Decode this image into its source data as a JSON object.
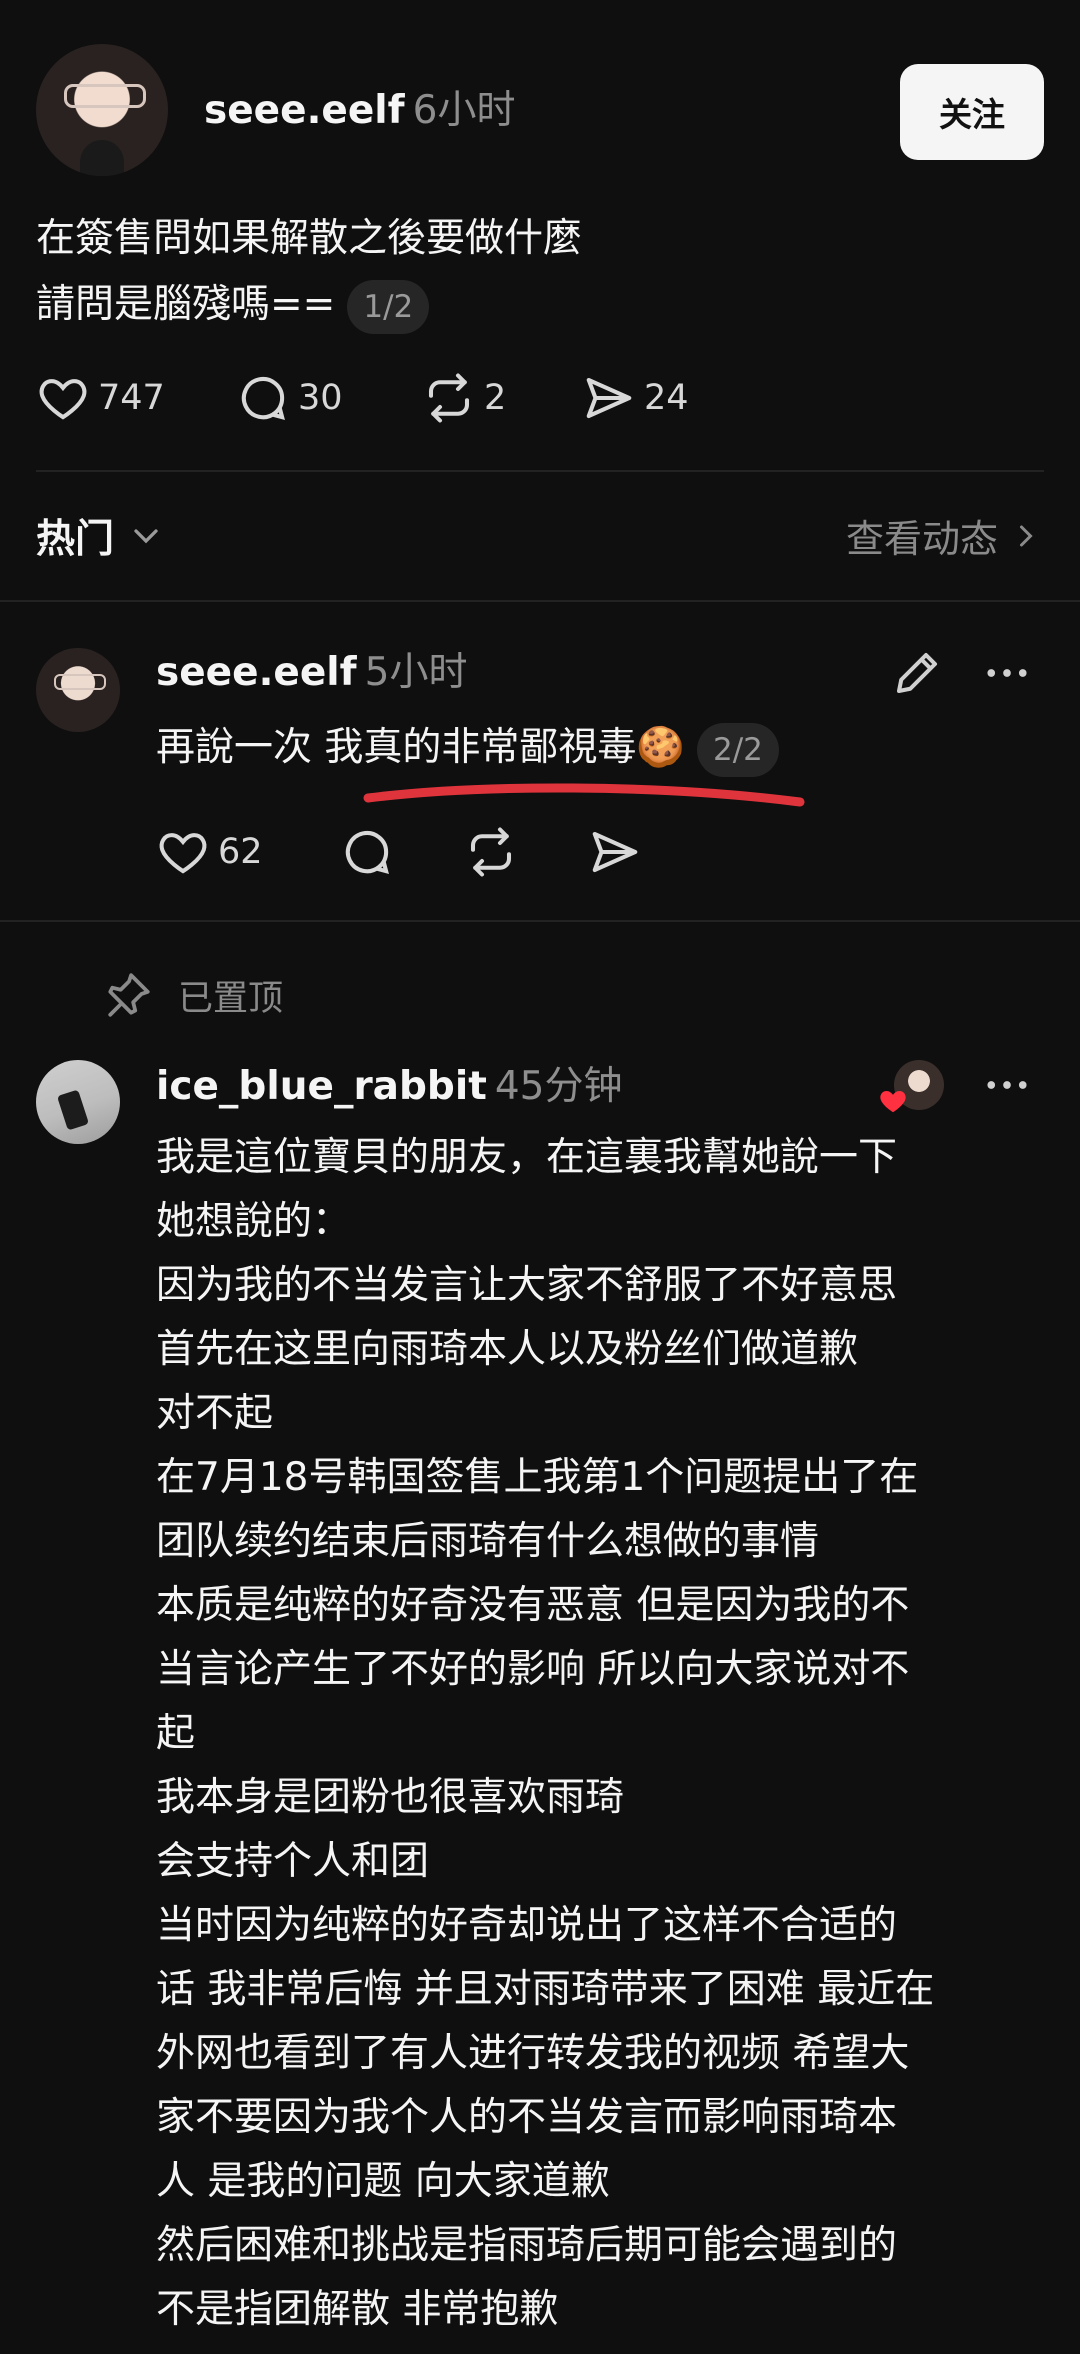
{
  "post": {
    "username": "seee.eelf",
    "time": "6小时",
    "follow_label": "关注",
    "lines": [
      "在簽售問如果解散之後要做什麼",
      "請問是腦殘嗎=="
    ],
    "page_badge": "1/2",
    "likes": "747",
    "comments": "30",
    "reposts": "2",
    "shares": "24"
  },
  "sort": {
    "label": "热门",
    "view_activity": "查看动态"
  },
  "reply1": {
    "username": "seee.eelf",
    "time": "5小时",
    "text": "再說一次 我真的非常鄙視毒🍪",
    "page_badge": "2/2",
    "likes": "62"
  },
  "pinned_label": "已置顶",
  "reply2": {
    "username": "ice_blue_rabbit",
    "time": "45分钟",
    "lines": [
      "我是這位寶貝的朋友，在這裏我幫她說一下",
      "她想說的：",
      "因为我的不当发言让大家不舒服了不好意思",
      "首先在这里向雨琦本人以及粉丝们做道歉",
      "对不起",
      "在7月18号韩国签售上我第1个问题提出了在",
      "团队续约结束后雨琦有什么想做的事情",
      "本质是纯粹的好奇没有恶意 但是因为我的不",
      "当言论产生了不好的影响 所以向大家说对不",
      "起",
      "我本身是团粉也很喜欢雨琦",
      "会支持个人和团",
      "当时因为纯粹的好奇却说出了这样不合适的",
      "话 我非常后悔 并且对雨琦带来了困难 最近在",
      "外网也看到了有人进行转发我的视频 希望大",
      "家不要因为我个人的不当发言而影响雨琦本",
      "人 是我的问题 向大家道歉",
      "然后困难和挑战是指雨琦后期可能会遇到的",
      "不是指团解散 非常抱歉"
    ]
  },
  "colors": {
    "background": "#0f0f0f",
    "text": "#f5f5f5",
    "muted": "#8e8e8e",
    "underline_annotation": "#e0343c",
    "like_heart": "#ff3040"
  }
}
